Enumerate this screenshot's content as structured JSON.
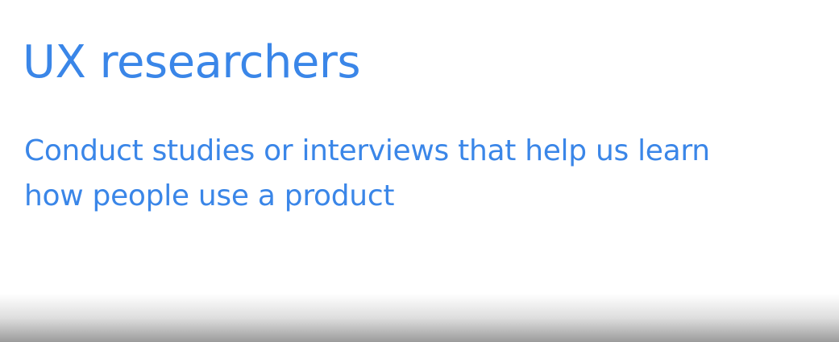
{
  "slide": {
    "title": "UX researchers",
    "body_lines": [
      "Conduct studies or interviews that help us learn",
      "how people use a product"
    ]
  },
  "colors": {
    "text": "#3a86e8",
    "background": "#ffffff"
  }
}
